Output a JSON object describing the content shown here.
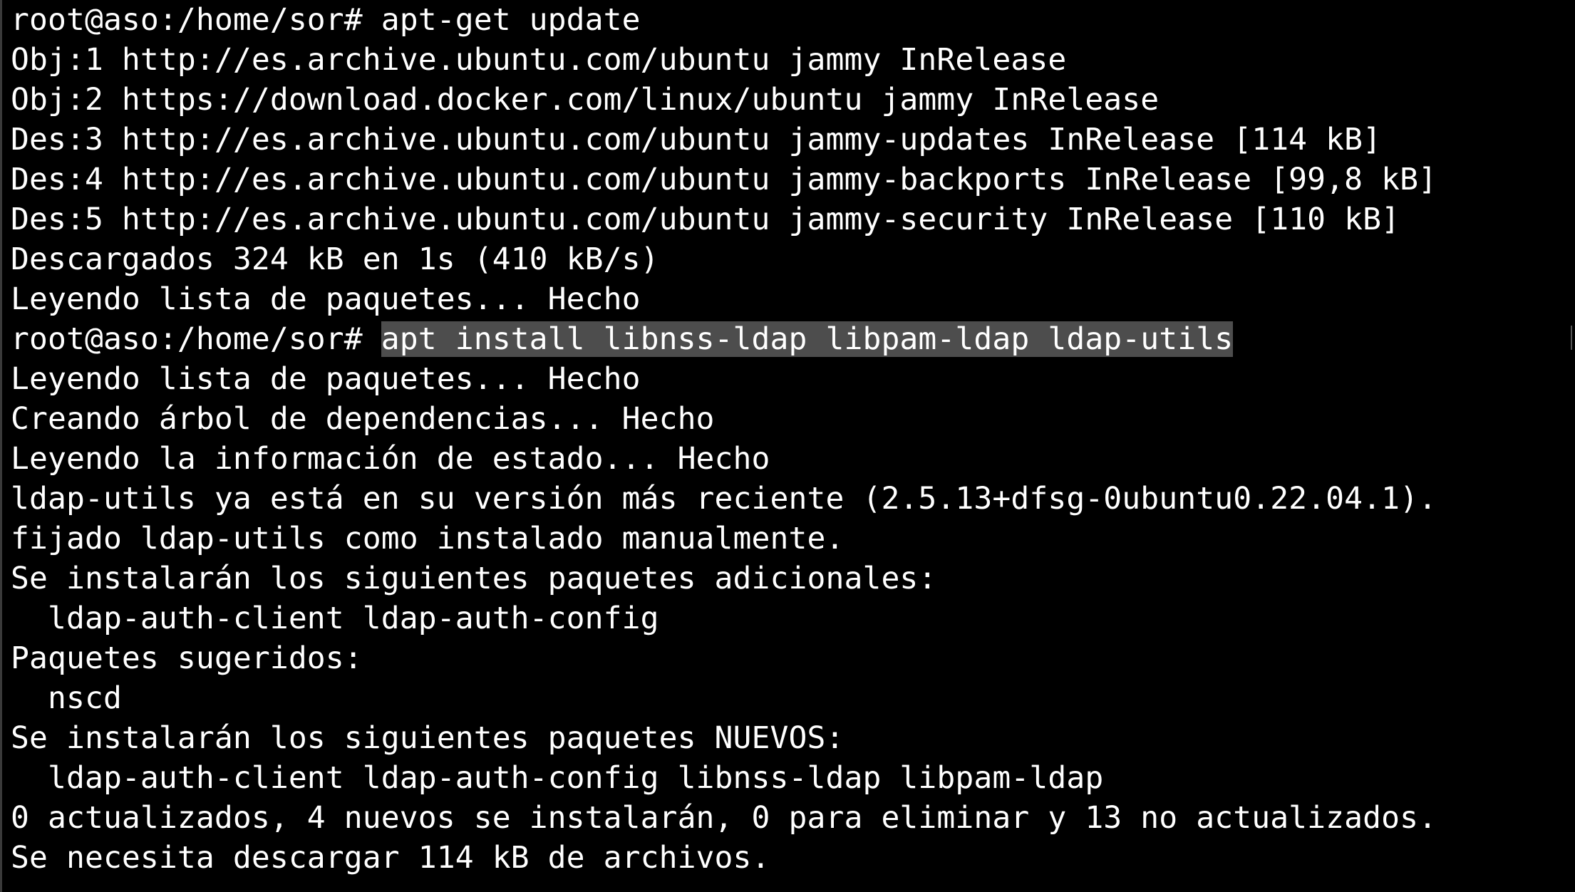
{
  "terminal": {
    "background": "#000000",
    "foreground": "#ffffff",
    "selection_color": "#4d4d4d",
    "lines": [
      {
        "prompt": "root@aso:/home/sor# ",
        "command": "apt-get update",
        "highlighted": false
      },
      {
        "text": "Obj:1 http://es.archive.ubuntu.com/ubuntu jammy InRelease"
      },
      {
        "text": "Obj:2 https://download.docker.com/linux/ubuntu jammy InRelease"
      },
      {
        "text": "Des:3 http://es.archive.ubuntu.com/ubuntu jammy-updates InRelease [114 kB]"
      },
      {
        "text": "Des:4 http://es.archive.ubuntu.com/ubuntu jammy-backports InRelease [99,8 kB]"
      },
      {
        "text": "Des:5 http://es.archive.ubuntu.com/ubuntu jammy-security InRelease [110 kB]"
      },
      {
        "text": "Descargados 324 kB en 1s (410 kB/s)"
      },
      {
        "text": "Leyendo lista de paquetes... Hecho"
      },
      {
        "prompt": "root@aso:/home/sor# ",
        "command": "apt install libnss-ldap libpam-ldap ldap-utils",
        "highlighted": true
      },
      {
        "text": "Leyendo lista de paquetes... Hecho"
      },
      {
        "text": "Creando árbol de dependencias... Hecho"
      },
      {
        "text": "Leyendo la información de estado... Hecho"
      },
      {
        "text": "ldap-utils ya está en su versión más reciente (2.5.13+dfsg-0ubuntu0.22.04.1)."
      },
      {
        "text": "fijado ldap-utils como instalado manualmente."
      },
      {
        "text": "Se instalarán los siguientes paquetes adicionales:"
      },
      {
        "text": "  ldap-auth-client ldap-auth-config"
      },
      {
        "text": "Paquetes sugeridos:"
      },
      {
        "text": "  nscd"
      },
      {
        "text": "Se instalarán los siguientes paquetes NUEVOS:"
      },
      {
        "text": "  ldap-auth-client ldap-auth-config libnss-ldap libpam-ldap"
      },
      {
        "text": "0 actualizados, 4 nuevos se instalarán, 0 para eliminar y 13 no actualizados."
      },
      {
        "text": "Se necesita descargar 114 kB de archivos."
      }
    ]
  }
}
